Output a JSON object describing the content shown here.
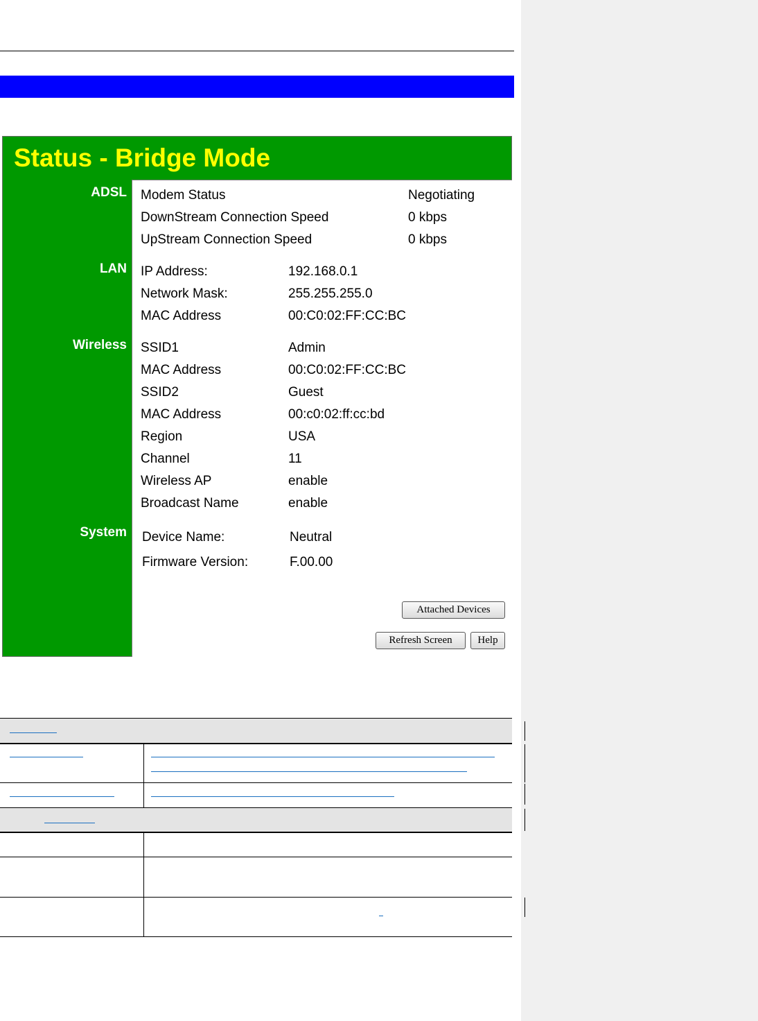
{
  "status_page": {
    "title": "Status - Bridge Mode",
    "sections": {
      "adsl": {
        "label": "ADSL",
        "rows": [
          {
            "label": "Modem Status",
            "value": "Negotiating"
          },
          {
            "label": "DownStream Connection Speed",
            "value": "0 kbps"
          },
          {
            "label": "UpStream Connection Speed",
            "value": "0 kbps"
          }
        ]
      },
      "lan": {
        "label": "LAN",
        "rows": [
          {
            "label": "IP Address:",
            "value": "192.168.0.1"
          },
          {
            "label": "Network Mask:",
            "value": "255.255.255.0"
          },
          {
            "label": "MAC Address",
            "value": "00:C0:02:FF:CC:BC"
          }
        ]
      },
      "wireless": {
        "label": "Wireless",
        "rows": [
          {
            "label": "SSID1",
            "value": "Admin"
          },
          {
            "label": "MAC Address",
            "value": "00:C0:02:FF:CC:BC"
          },
          {
            "label": "SSID2",
            "value": "Guest"
          },
          {
            "label": "MAC Address",
            "value": "00:c0:02:ff:cc:bd"
          },
          {
            "label": "Region",
            "value": "USA"
          },
          {
            "label": "Channel",
            "value": "11"
          },
          {
            "label": "Wireless AP",
            "value": "enable"
          },
          {
            "label": "Broadcast Name",
            "value": "enable"
          }
        ]
      },
      "system": {
        "label": "System",
        "rows": [
          {
            "label": "Device Name:",
            "value": "Neutral"
          },
          {
            "label": "Firmware Version:",
            "value": "F.00.00"
          }
        ]
      }
    },
    "buttons": {
      "attached_devices": "Attached Devices",
      "refresh_screen": "Refresh Screen",
      "help": "Help"
    }
  },
  "colors": {
    "green": "#009900",
    "title_yellow": "#ffff00",
    "blue_bar": "#0000ff",
    "link_blue": "#1a6fc0",
    "table_header_grey": "#e4e4e4",
    "side_panel_grey": "#f0f0f0"
  }
}
